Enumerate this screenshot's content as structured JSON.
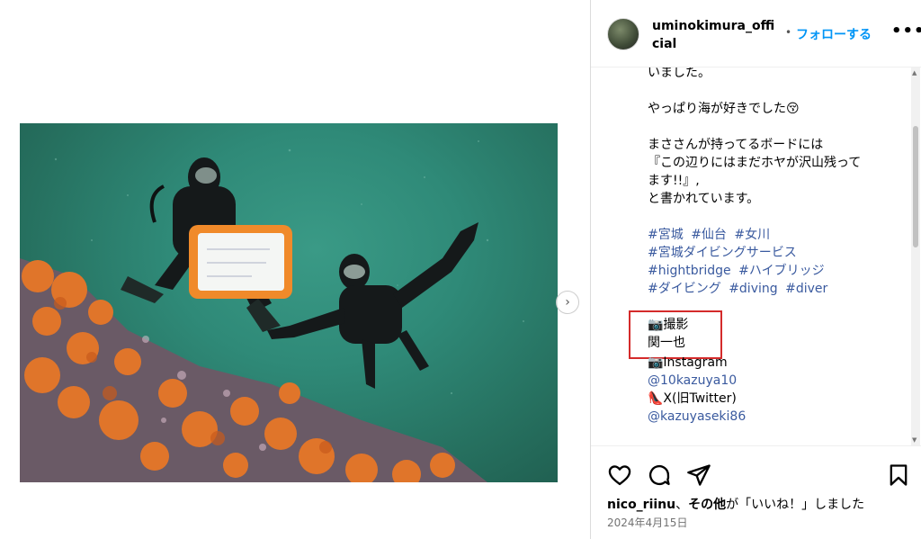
{
  "post": {
    "username": "uminokimura_official",
    "separator_dot": "•",
    "follow_label": "フォローする",
    "more_label": "•••",
    "next_label": "›"
  },
  "caption": {
    "line1": "いました。",
    "line2": "やっぱり海が好きでした😚",
    "line3": "まささんが持ってるボードには",
    "line4": "『この辺りにはまだホヤが沢山残って",
    "line5": "ます!!』,",
    "line6": "と書かれています。",
    "hashtags_row1": [
      "#宮城",
      "#仙台",
      "#女川"
    ],
    "hashtags_row2": [
      "#宮城ダイビングサービス"
    ],
    "hashtags_row3": [
      "#hightbridge",
      "#ハイブリッジ"
    ],
    "hashtags_row4": [
      "#ダイビング",
      "#diving",
      "#diver"
    ],
    "credit_label": "📷撮影",
    "credit_name": "関一也",
    "instagram_label": "📷Instagram",
    "instagram_handle": "@10kazuya10",
    "x_label": "👠X(旧Twitter)",
    "x_handle": "@kazuyaseki86"
  },
  "footer": {
    "liker": "nico_riinu",
    "liker_sep": "、",
    "others": "その他",
    "like_text": "が「いいね！」しました",
    "date": "2024年4月15日"
  },
  "icons": {
    "heart": "heart-icon",
    "comment": "comment-icon",
    "share": "share-icon",
    "save": "bookmark-icon"
  },
  "colors": {
    "follow": "#0095f6",
    "hashtag": "#3a5a9f",
    "highlight": "#d42b2b"
  }
}
